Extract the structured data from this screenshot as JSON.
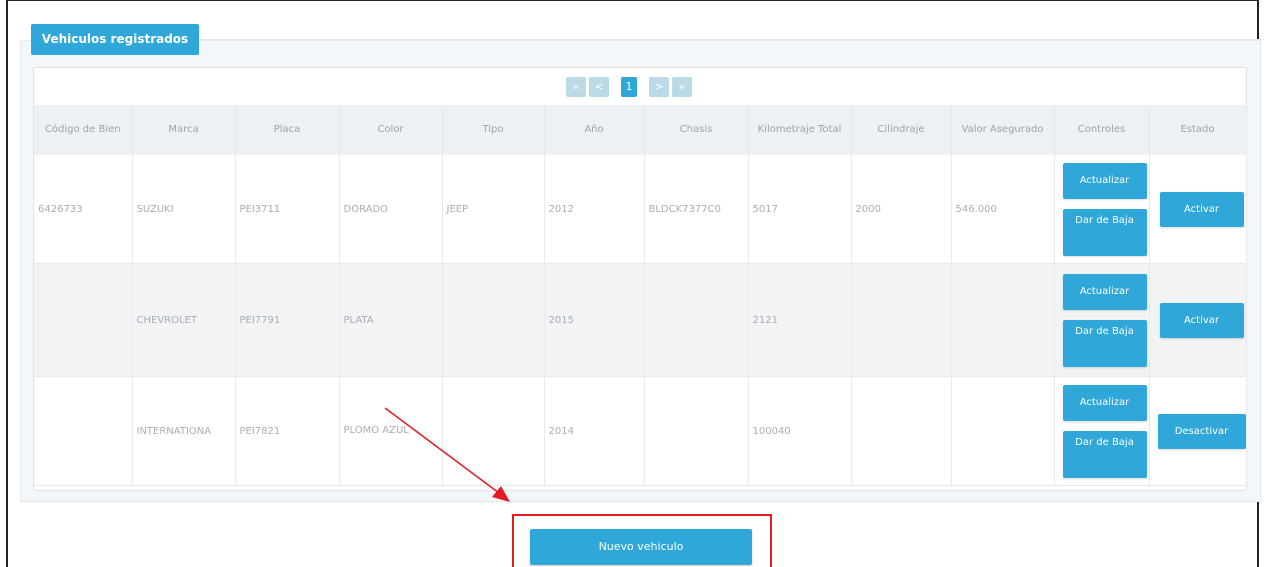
{
  "panel": {
    "title": "Vehiculos registrados"
  },
  "pagination": {
    "first": "«",
    "prev": "<",
    "current": "1",
    "next": ">",
    "last": "»"
  },
  "table": {
    "headers": [
      "Código de Bien",
      "Marca",
      "Placa",
      "Color",
      "Tipo",
      "Año",
      "Chasis",
      "Kilometraje Total",
      "Cilindraje",
      "Valor Asegurado",
      "Controles",
      "Estado"
    ],
    "rows": [
      {
        "codigo": "6426733",
        "marca": "SUZUKI",
        "placa": "PEI3711",
        "color": "DORADO",
        "tipo": "JEEP",
        "anio": "2012",
        "chasis": "BLDCK7377C0",
        "km": "5017",
        "cilindraje": "2000",
        "valor": "546.000",
        "btn_update": "Actualizar",
        "btn_down": "Dar de Baja",
        "btn_state": "Activar"
      },
      {
        "codigo": "",
        "marca": "CHEVROLET",
        "placa": "PEI7791",
        "color": "PLATA",
        "tipo": "",
        "anio": "2015",
        "chasis": "",
        "km": "2121",
        "cilindraje": "",
        "valor": "",
        "btn_update": "Actualizar",
        "btn_down": "Dar de Baja",
        "btn_state": "Activar"
      },
      {
        "codigo": "",
        "marca": "INTERNATIONA",
        "placa": "PEI7821",
        "color": "PLOMO AZUL",
        "tipo": "",
        "anio": "2014",
        "chasis": "",
        "km": "100040",
        "cilindraje": "",
        "valor": "",
        "btn_update": "Actualizar",
        "btn_down": "Dar de Baja",
        "btn_state": "Desactivar"
      }
    ]
  },
  "new_button": "Nuevo vehiculo",
  "colors": {
    "accent": "#2fa7d9",
    "annotation": "#e31b23"
  }
}
